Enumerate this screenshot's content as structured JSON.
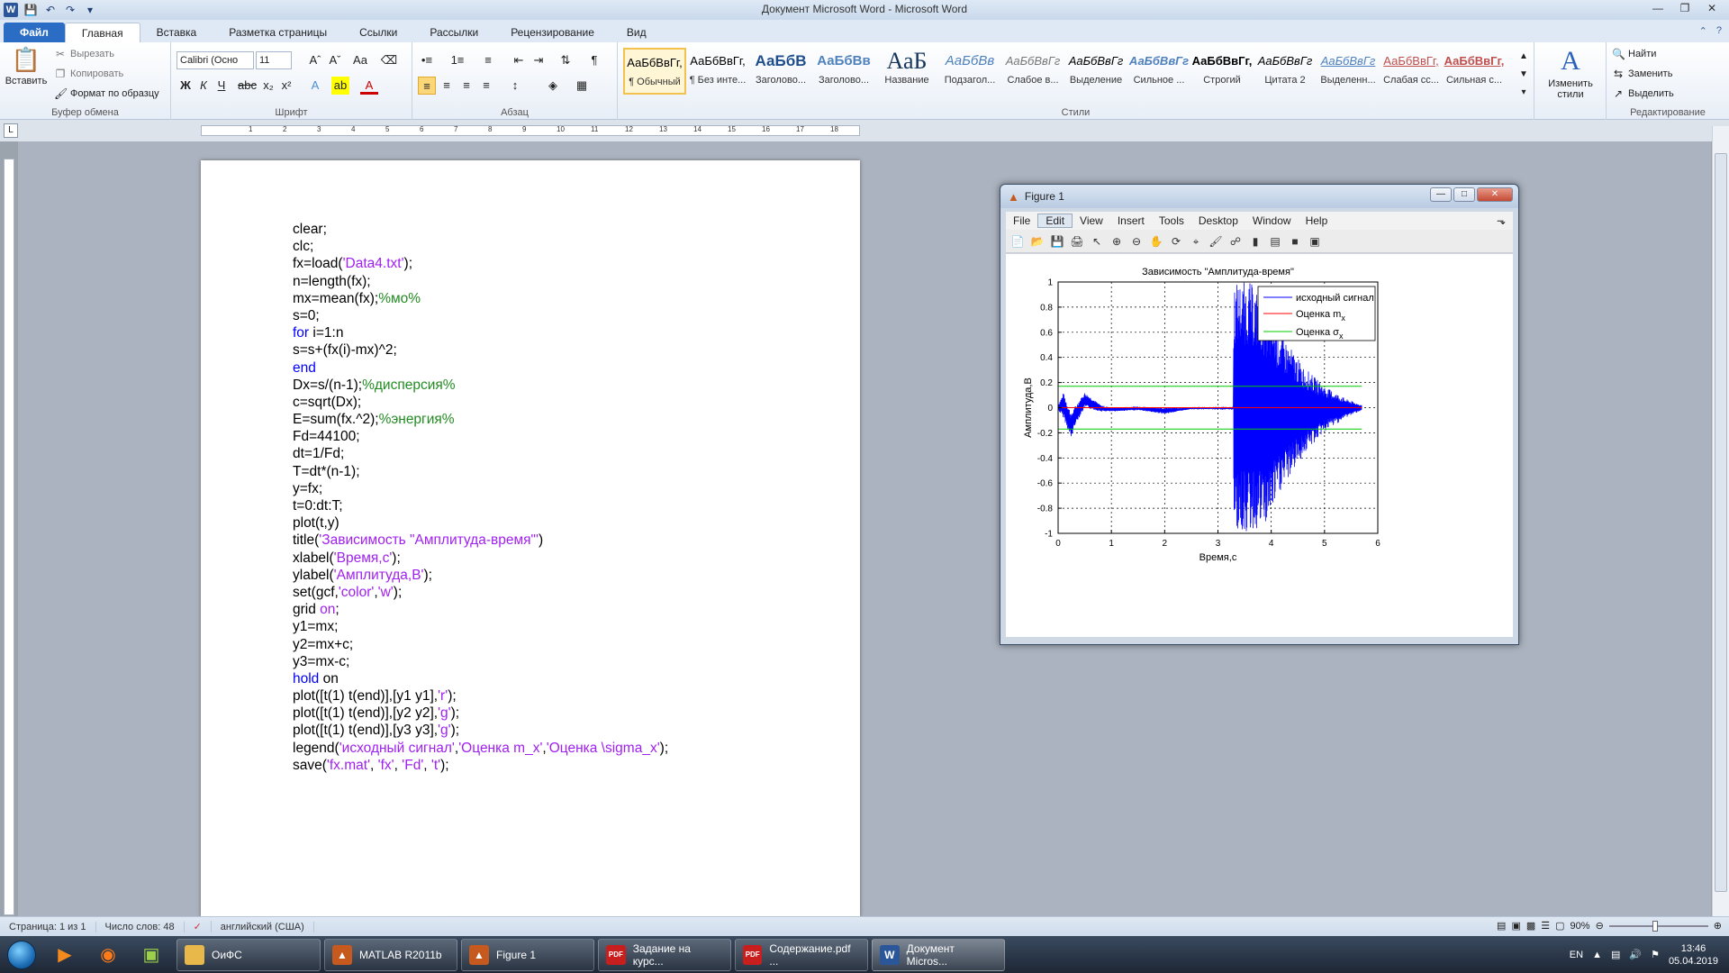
{
  "window": {
    "title": "Документ Microsoft Word - Microsoft Word",
    "help": "?"
  },
  "tabs": [
    "Файл",
    "Главная",
    "Вставка",
    "Разметка страницы",
    "Ссылки",
    "Рассылки",
    "Рецензирование",
    "Вид"
  ],
  "clipboard": {
    "paste": "Вставить",
    "cut": "Вырезать",
    "copy": "Копировать",
    "format_painter": "Формат по образцу",
    "label": "Буфер обмена"
  },
  "font": {
    "family": "Calibri (Осно",
    "size": "11",
    "label": "Шрифт"
  },
  "paragraph": {
    "label": "Абзац"
  },
  "styles": {
    "label": "Стили",
    "items": [
      {
        "sample": "АаБбВвГг,",
        "name": "¶ Обычный"
      },
      {
        "sample": "АаБбВвГг,",
        "name": "¶ Без инте..."
      },
      {
        "sample": "АаБбВ",
        "name": "Заголово..."
      },
      {
        "sample": "АаБбВв",
        "name": "Заголово..."
      },
      {
        "sample": "АаБ",
        "name": "Название"
      },
      {
        "sample": "АаБбВв",
        "name": "Подзагол..."
      },
      {
        "sample": "АаБбВвГг",
        "name": "Слабое в..."
      },
      {
        "sample": "АаБбВвГг",
        "name": "Выделение"
      },
      {
        "sample": "АаБбВвГг",
        "name": "Сильное ..."
      },
      {
        "sample": "АаБбВвГг,",
        "name": "Строгий"
      },
      {
        "sample": "АаБбВвГг",
        "name": "Цитата 2"
      },
      {
        "sample": "АаБбВвГг",
        "name": "Выделенн..."
      },
      {
        "sample": "АаБбВвГг,",
        "name": "Слабая сс..."
      },
      {
        "sample": "АаБбВвГг,",
        "name": "Сильная с..."
      }
    ],
    "change": "Изменить стили"
  },
  "editing": {
    "find": "Найти",
    "replace": "Заменить",
    "select": "Выделить",
    "label": "Редактирование"
  },
  "code_lines": [
    "clear;",
    "clc;",
    "fx=load('Data4.txt');",
    "n=length(fx);",
    "mx=mean(fx);%мо%",
    "s=0;",
    "for i=1:n",
    "s=s+(fx(i)-mx)^2;",
    "end",
    "Dx=s/(n-1);%дисперсия%",
    "c=sqrt(Dx);",
    "E=sum(fx.^2);%энергия%",
    "Fd=44100;",
    "dt=1/Fd;",
    "T=dt*(n-1);",
    "y=fx;",
    "t=0:dt:T;",
    "plot(t,y)",
    "title('Зависимость \"Амплитуда-время\"')",
    "xlabel('Время,с');",
    "ylabel('Амплитуда,В');",
    "set(gcf,'color','w');",
    "grid on;",
    "y1=mx;",
    "y2=mx+c;",
    "y3=mx-c;",
    "hold on",
    "plot([t(1) t(end)],[y1 y1],'r');",
    "plot([t(1) t(end)],[y2 y2],'g');",
    "plot([t(1) t(end)],[y3 y3],'g');",
    "legend('исходный сигнал','Оценка m_x','Оценка \\sigma_x');",
    "save('fx.mat', 'fx', 'Fd', 't');"
  ],
  "status": {
    "page": "Страница: 1 из 1",
    "words": "Число слов: 48",
    "lang": "английский (США)",
    "zoom": "90%"
  },
  "taskbar": {
    "items": [
      {
        "label": "ОиФС",
        "icon": "folder-icon",
        "color": "#e8b84a"
      },
      {
        "label": "MATLAB  R2011b",
        "icon": "matlab-icon",
        "color": "#c65a1e"
      },
      {
        "label": "Figure 1",
        "icon": "matlab-icon",
        "color": "#c65a1e"
      },
      {
        "label": "Задание на курс...",
        "icon": "pdf-icon",
        "color": "#c81e1e"
      },
      {
        "label": "Содержание.pdf ...",
        "icon": "pdf-icon",
        "color": "#c81e1e"
      },
      {
        "label": "Документ Micros...",
        "icon": "word-icon",
        "color": "#2b579a"
      }
    ],
    "lang": "EN",
    "time": "13:46",
    "date": "05.04.2019"
  },
  "figure": {
    "title": "Figure 1",
    "menu": [
      "File",
      "Edit",
      "View",
      "Insert",
      "Tools",
      "Desktop",
      "Window",
      "Help"
    ],
    "active_menu": "Edit"
  },
  "chart_data": {
    "type": "line",
    "title": "Зависимость \"Амплитуда-время\"",
    "xlabel": "Время,с",
    "ylabel": "Амплитуда,В",
    "xlim": [
      0,
      6
    ],
    "ylim": [
      -1,
      1
    ],
    "xticks": [
      0,
      1,
      2,
      3,
      4,
      5,
      6
    ],
    "yticks": [
      1,
      0.8,
      0.6,
      0.4,
      0.2,
      0,
      -0.2,
      -0.4,
      -0.6,
      -0.8,
      -1
    ],
    "grid": true,
    "legend_position": "top-right",
    "series": [
      {
        "name": "исходный сигнал",
        "color": "#0000ff",
        "envelope": {
          "x": [
            0,
            0.1,
            0.25,
            0.3,
            0.5,
            0.8,
            1.0,
            1.5,
            2.0,
            2.5,
            3.0,
            3.29,
            3.3,
            3.6,
            3.9,
            4.2,
            4.6,
            5.0,
            5.4,
            5.7
          ],
          "upper": [
            0.02,
            0.12,
            -0.05,
            0.0,
            0.12,
            0.02,
            0.0,
            0.01,
            0.0,
            0.0,
            0.0,
            0.0,
            1.0,
            1.0,
            0.85,
            0.58,
            0.33,
            0.17,
            0.07,
            0.02
          ],
          "lower": [
            -0.02,
            -0.08,
            -0.25,
            -0.15,
            0.0,
            -0.03,
            -0.03,
            -0.02,
            -0.05,
            -0.01,
            -0.01,
            -0.01,
            -1.0,
            -1.0,
            -0.95,
            -0.65,
            -0.38,
            -0.19,
            -0.08,
            -0.02
          ]
        }
      },
      {
        "name": "Оценка m_x",
        "color": "#ff0000",
        "x": [
          0,
          5.7
        ],
        "y": [
          0.0,
          0.0
        ]
      },
      {
        "name": "Оценка σ_x",
        "color": "#00cc00",
        "x": [
          0,
          5.7
        ],
        "y": [
          0.17,
          0.17
        ]
      },
      {
        "name": "",
        "color": "#00cc00",
        "x": [
          0,
          5.7
        ],
        "y": [
          -0.17,
          -0.17
        ]
      }
    ]
  }
}
